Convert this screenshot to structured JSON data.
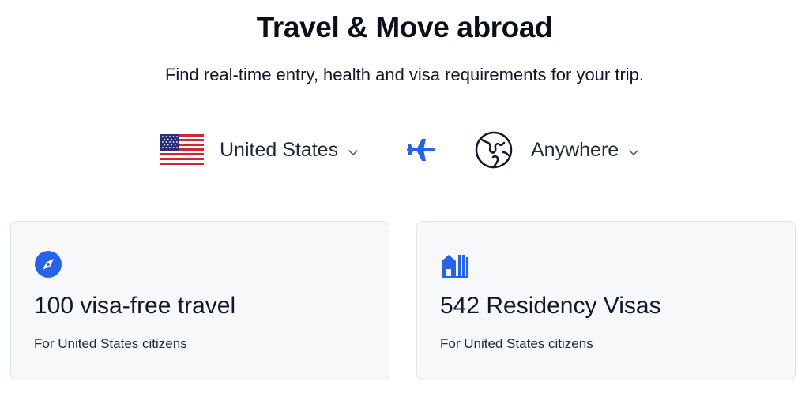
{
  "header": {
    "title": "Travel & Move abroad",
    "subtitle": "Find real-time entry, health and visa requirements for your trip."
  },
  "route": {
    "from": {
      "label": "United States",
      "icon": "us-flag-icon"
    },
    "separator_icon": "airplane-icon",
    "to": {
      "label": "Anywhere",
      "icon": "globe-icon"
    }
  },
  "cards": [
    {
      "icon": "compass-icon",
      "title": "100 visa-free travel",
      "subtitle": "For United States citizens"
    },
    {
      "icon": "buildings-icon",
      "title": "542 Residency Visas",
      "subtitle": "For United States citizens"
    }
  ],
  "colors": {
    "accent": "#2563eb",
    "card_background": "#f7f8fa",
    "card_border": "#dfe3e8",
    "text": "#111827"
  }
}
